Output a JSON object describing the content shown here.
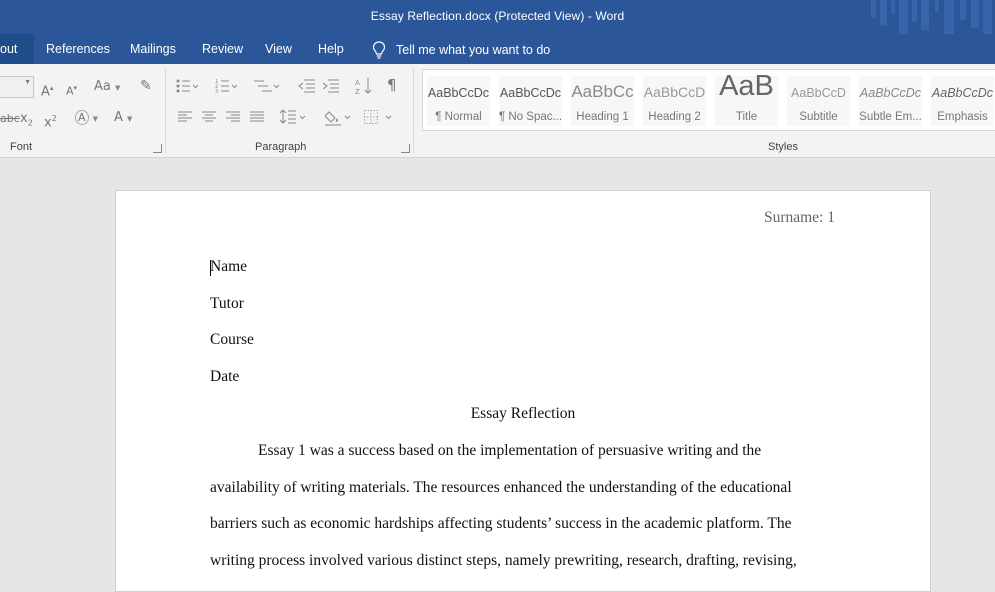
{
  "window": {
    "title": "Essay Reflection.docx (Protected View)  -  Word"
  },
  "tabs": [
    {
      "label": "out"
    },
    {
      "label": "References"
    },
    {
      "label": "Mailings"
    },
    {
      "label": "Review"
    },
    {
      "label": "View"
    },
    {
      "label": "Help"
    }
  ],
  "tell_me": {
    "label": "Tell me what you want to do",
    "icon": "lightbulb-icon"
  },
  "ribbon": {
    "groups": {
      "font": "Font",
      "paragraph": "Paragraph",
      "styles": "Styles"
    },
    "font_icons": {
      "grow": "A",
      "shrink": "A",
      "case": "Aa",
      "subscript": "x",
      "superscript": "x",
      "sub_mark": "2",
      "sup_mark": "2",
      "strike": "abc",
      "font_color": "A",
      "text_effects": "A"
    },
    "styles": [
      {
        "sample": "AaBbCcDc",
        "name": "¶ Normal"
      },
      {
        "sample": "AaBbCcDc",
        "name": "¶ No Spac..."
      },
      {
        "sample": "AaBbCc",
        "name": "Heading 1"
      },
      {
        "sample": "AaBbCcD",
        "name": "Heading 2"
      },
      {
        "sample": "AaB",
        "name": "Title"
      },
      {
        "sample": "AaBbCcD",
        "name": "Subtitle"
      },
      {
        "sample": "AaBbCcDc",
        "name": "Subtle Em..."
      },
      {
        "sample": "AaBbCcDc",
        "name": "Emphasis"
      }
    ],
    "colors": {
      "accent": "#2b579a",
      "ribbon_bg": "#f3f3f3"
    }
  },
  "document": {
    "header": "Surname: 1",
    "lines": {
      "name": "Name",
      "tutor": "Tutor",
      "course": "Course",
      "date": "Date"
    },
    "title": "Essay Reflection",
    "paragraph": [
      "Essay 1 was a success based on the implementation of persuasive writing and the",
      "availability of writing materials. The resources enhanced the understanding of the educational",
      "barriers such as economic hardships affecting students’ success in the academic platform. The",
      "writing process involved various distinct steps, namely prewriting, research, drafting, revising,"
    ]
  }
}
